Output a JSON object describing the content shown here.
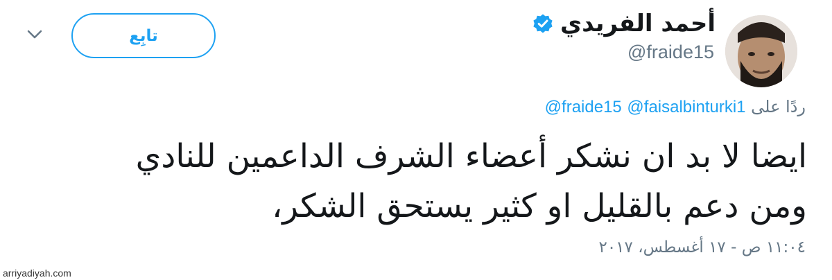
{
  "user": {
    "display_name": "أحمد الفريدي",
    "handle": "@fraide15",
    "verified": true
  },
  "follow_button": {
    "label": "تابِع"
  },
  "reply": {
    "prefix": "ردًا على",
    "mentions": [
      "@faisalbinturki1",
      "@fraide15"
    ]
  },
  "tweet": {
    "lines": [
      "ايضا لا بد ان نشكر أعضاء الشرف الداعمين للنادي",
      "ومن دعم بالقليل او كثير يستحق الشكر،"
    ]
  },
  "timestamp": "١١:٠٤ ص - ١٧ أغسطس، ٢٠١٧",
  "watermark": "arriyadiyah.com",
  "colors": {
    "accent": "#1da1f2",
    "muted": "#657786",
    "text": "#14171a"
  },
  "icons": {
    "verified": "verified-badge-icon",
    "menu": "chevron-down-icon"
  }
}
